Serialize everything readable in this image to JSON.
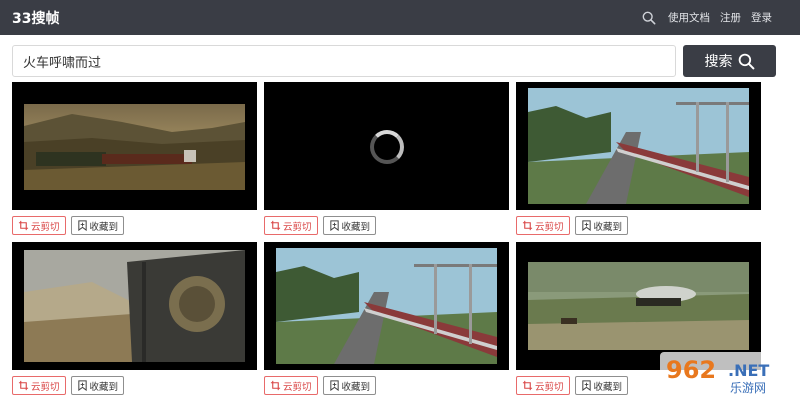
{
  "header": {
    "logo": "33搜帧",
    "nav": [
      "使用文档",
      "注册",
      "登录"
    ]
  },
  "search": {
    "value": "火车呼啸而过",
    "button_label": "搜索"
  },
  "card_actions": {
    "clip_label": "云剪切",
    "fav_label": "收藏到"
  },
  "results": [
    {
      "scene": "train-valley-sunset"
    },
    {
      "scene": "loading"
    },
    {
      "scene": "train-station-curve"
    },
    {
      "scene": "steam-locomotive-side"
    },
    {
      "scene": "train-station-curve"
    },
    {
      "scene": "steam-train-field"
    }
  ],
  "watermark": {
    "top": "962",
    "suffix": ".NET",
    "bottom": "乐游网"
  },
  "colors": {
    "topbar": "#3a3d45",
    "clip_border": "#e86a6a",
    "fav_border": "#8f8f8f"
  }
}
